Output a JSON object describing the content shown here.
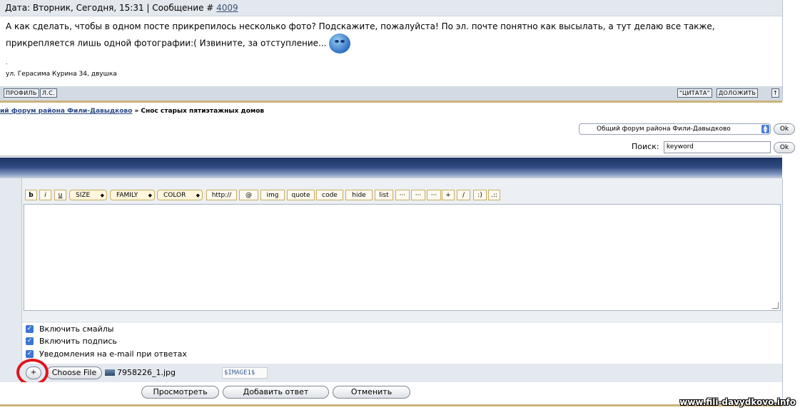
{
  "post": {
    "header_prefix": "Дата: Вторник, Сегодня, 15:31 | Сообщение # ",
    "message_number": "4009",
    "text": "А как сделать, чтобы в одном посте прикрепилось несколько фото? Подскажите, пожалуйста! По эл. почте понятно как высылать, а тут делаю все также, прикрепляется лишь одной фотографии:( Извините, за отступление...",
    "dot": ".",
    "signature": "ул. Герасима Курина 34, двушка",
    "footer_buttons": [
      "ПРОФИЛЬ",
      "Л.С."
    ],
    "quote_label": "\"ЦИТАТА\"",
    "reply_label": "ДОЛОЖИТЬ",
    "top_label": "↑"
  },
  "breadcrumb": {
    "forum": "ий форум района Фили-Давыдково",
    "separator": " » ",
    "topic": "Снос старых пятиэтажных домов"
  },
  "forum_select": {
    "selected": "Общий форум района Фили-Давыдково",
    "ok_label": "Ok"
  },
  "search": {
    "label": "Поиск:",
    "value": "keyword",
    "ok_label": "Ok"
  },
  "toolbar": {
    "bold": "b",
    "italic": "i",
    "underline": "u",
    "size": "SIZE",
    "family": "FAMILY",
    "color": "COLOR",
    "buttons": [
      "http://",
      "@",
      "img",
      "quote",
      "code",
      "hide",
      "list",
      "···",
      "···",
      "···",
      "+",
      "/",
      ":)",
      ".::"
    ]
  },
  "options": {
    "smiles": "Включить смайлы",
    "signature": "Включить подпись",
    "notify": "Уведомления на e-mail при ответах"
  },
  "attach": {
    "add_label": "+",
    "choose_label": "Choose File",
    "file_name": "7958226_1.jpg",
    "tag": "$IMAGE1$"
  },
  "actions": {
    "preview": "Просмотреть",
    "submit": "Добавить ответ",
    "cancel": "Отменить"
  },
  "watermark": "www.fili-davydkovo.info"
}
